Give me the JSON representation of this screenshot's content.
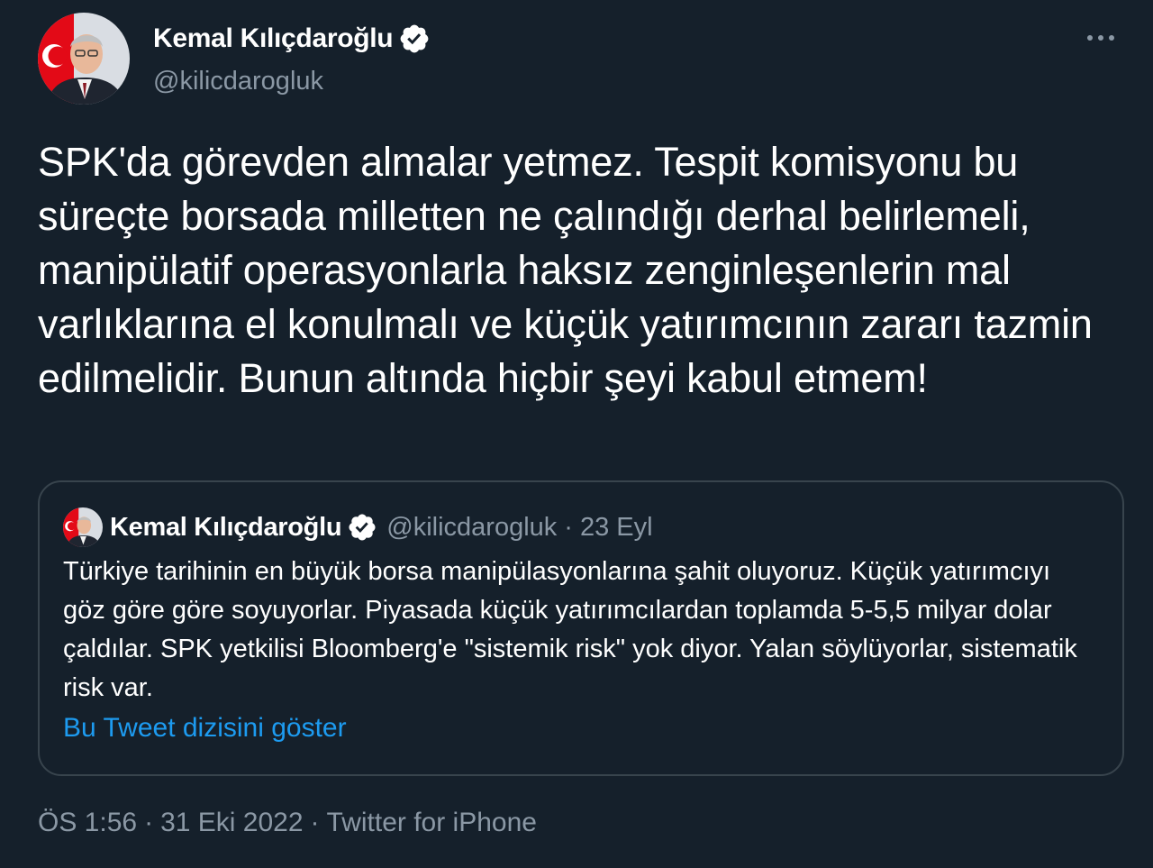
{
  "author": {
    "display_name": "Kemal Kılıçdaroğlu",
    "handle": "@kilicdarogluk"
  },
  "tweet": {
    "text": "SPK'da görevden almalar yetmez. Tespit komisyonu bu süreçte borsada milletten ne çalındığı derhal belirlemeli, manipülatif operasyonlarla haksız zenginleşenlerin mal varlıklarına el konulmalı ve küçük yatırımcının zararı tazmin edilmelidir. Bunun altında hiçbir şeyi kabul etmem!"
  },
  "quoted_tweet": {
    "display_name": "Kemal Kılıçdaroğlu",
    "handle": "@kilicdarogluk",
    "separator": "·",
    "date": "23 Eyl",
    "text": "Türkiye tarihinin en büyük borsa manipülasyonlarına şahit oluyoruz. Küçük yatırımcıyı göz göre göre soyuyorlar. Piyasada küçük yatırımcılardan toplamda 5-5,5 milyar dolar çaldılar. SPK yetkilisi Bloomberg'e \"sistemik risk\" yok diyor. Yalan söylüyorlar, sistematik risk var.",
    "thread_link": "Bu Tweet dizisini göster"
  },
  "meta": {
    "time": "ÖS 1:56",
    "separator": "·",
    "date": "31 Eki 2022",
    "source": "Twitter for iPhone"
  },
  "icons": {
    "verified": "verified-badge-icon",
    "more": "more-options-icon"
  },
  "colors": {
    "background": "#15202b",
    "text_primary": "#ffffff",
    "text_secondary": "#8b98a5",
    "link": "#1d9bf0",
    "border": "#38444d"
  }
}
